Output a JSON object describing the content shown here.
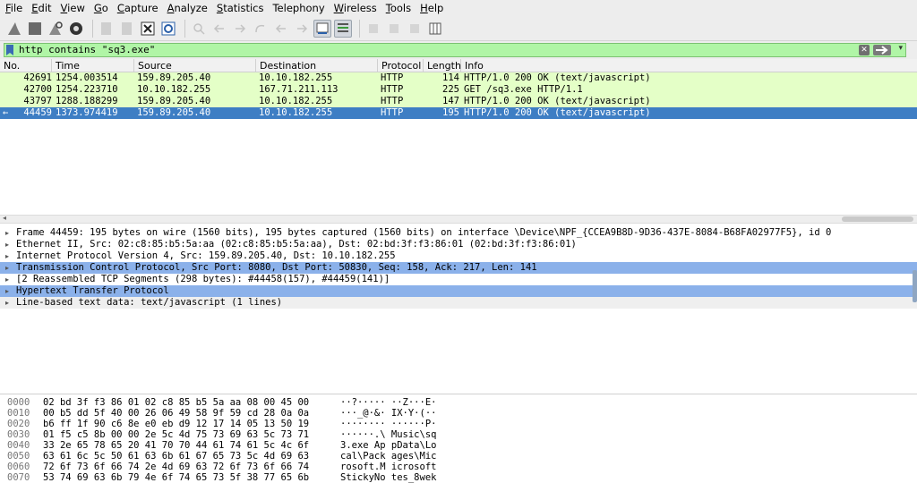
{
  "menu": [
    {
      "label": "File",
      "key": "F",
      "rest": "ile"
    },
    {
      "label": "Edit",
      "key": "E",
      "rest": "dit"
    },
    {
      "label": "View",
      "key": "V",
      "rest": "iew"
    },
    {
      "label": "Go",
      "key": "G",
      "rest": "o"
    },
    {
      "label": "Capture",
      "key": "C",
      "rest": "apture"
    },
    {
      "label": "Analyze",
      "key": "A",
      "rest": "nalyze"
    },
    {
      "label": "Statistics",
      "key": "S",
      "rest": "tatistics"
    },
    {
      "label": "Telephony",
      "key": "",
      "rest": "Telephony"
    },
    {
      "label": "Wireless",
      "key": "W",
      "rest": "ireless"
    },
    {
      "label": "Tools",
      "key": "T",
      "rest": "ools"
    },
    {
      "label": "Help",
      "key": "H",
      "rest": "elp"
    }
  ],
  "toolbar_icons": [
    "shark-fin-start-icon",
    "stop-square-icon",
    "restart-fin-icon",
    "gear-options-icon",
    "open-file-icon",
    "save-file-icon",
    "close-file-icon",
    "reload-icon",
    "find-icon",
    "back-arrow-icon",
    "forward-arrow-icon",
    "jump-icon",
    "first-packet-icon",
    "last-packet-icon",
    "autoscroll-icon",
    "colorize-icon",
    "zoom-in-icon",
    "zoom-out-icon",
    "normal-size-icon",
    "resize-columns-icon"
  ],
  "filter": {
    "text": "http contains \"sq3.exe\""
  },
  "columns": [
    "No.",
    "Time",
    "Source",
    "Destination",
    "Protocol",
    "Length",
    "Info"
  ],
  "packets": [
    {
      "no": "42691",
      "time": "1254.003514",
      "src": "159.89.205.40",
      "dst": "10.10.182.255",
      "proto": "HTTP",
      "len": "114",
      "info": "HTTP/1.0 200 OK  (text/javascript)",
      "style": "green"
    },
    {
      "no": "42700",
      "time": "1254.223710",
      "src": "10.10.182.255",
      "dst": "167.71.211.113",
      "proto": "HTTP",
      "len": "225",
      "info": "GET /sq3.exe HTTP/1.1",
      "style": "green"
    },
    {
      "no": "43797",
      "time": "1288.188299",
      "src": "159.89.205.40",
      "dst": "10.10.182.255",
      "proto": "HTTP",
      "len": "147",
      "info": "HTTP/1.0 200 OK  (text/javascript)",
      "style": "green"
    },
    {
      "no": "44459",
      "time": "1373.974419",
      "src": "159.89.205.40",
      "dst": "10.10.182.255",
      "proto": "HTTP",
      "len": "195",
      "info": "HTTP/1.0 200 OK  (text/javascript)",
      "style": "sel"
    }
  ],
  "details": [
    {
      "text": "Frame 44459: 195 bytes on wire (1560 bits), 195 bytes captured (1560 bits) on interface \\Device\\NPF_{CCEA9B8D-9D36-437E-8084-B68FA02977F5}, id 0",
      "style": ""
    },
    {
      "text": "Ethernet II, Src: 02:c8:85:b5:5a:aa (02:c8:85:b5:5a:aa), Dst: 02:bd:3f:f3:86:01 (02:bd:3f:f3:86:01)",
      "style": ""
    },
    {
      "text": "Internet Protocol Version 4, Src: 159.89.205.40, Dst: 10.10.182.255",
      "style": ""
    },
    {
      "text": "Transmission Control Protocol, Src Port: 8080, Dst Port: 50830, Seq: 158, Ack: 217, Len: 141",
      "style": "hl"
    },
    {
      "text": "[2 Reassembled TCP Segments (298 bytes): #44458(157), #44459(141)]",
      "style": ""
    },
    {
      "text": "Hypertext Transfer Protocol",
      "style": "hl"
    },
    {
      "text": "Line-based text data: text/javascript (1 lines)",
      "style": "stripe"
    }
  ],
  "bytes": [
    {
      "off": "0000",
      "hex": "02 bd 3f f3 86 01 02 c8  85 b5 5a aa 08 00 45 00",
      "ascii": "··?·····  ··Z···E·"
    },
    {
      "off": "0010",
      "hex": "00 b5 dd 5f 40 00 26 06  49 58 9f 59 cd 28 0a 0a",
      "ascii": "···_@·&·  IX·Y·(··"
    },
    {
      "off": "0020",
      "hex": "b6 ff 1f 90 c6 8e e0 eb  d9 12 17 14 05 13 50 19",
      "ascii": "········  ······P·"
    },
    {
      "off": "0030",
      "hex": "01 f5 c5 8b 00 00 2e 5c  4d 75 73 69 63 5c 73 71",
      "ascii": "······.\\ Music\\sq"
    },
    {
      "off": "0040",
      "hex": "33 2e 65 78 65 20 41 70  70 44 61 74 61 5c 4c 6f",
      "ascii": "3.exe Ap pData\\Lo"
    },
    {
      "off": "0050",
      "hex": "63 61 6c 5c 50 61 63 6b  61 67 65 73 5c 4d 69 63",
      "ascii": "cal\\Pack ages\\Mic"
    },
    {
      "off": "0060",
      "hex": "72 6f 73 6f 66 74 2e 4d  69 63 72 6f 73 6f 66 74",
      "ascii": "rosoft.M icrosoft"
    },
    {
      "off": "0070",
      "hex": "53 74 69 63 6b 79 4e 6f  74 65 73 5f 38 77 65 6b",
      "ascii": "StickyNo tes_8wek"
    }
  ]
}
